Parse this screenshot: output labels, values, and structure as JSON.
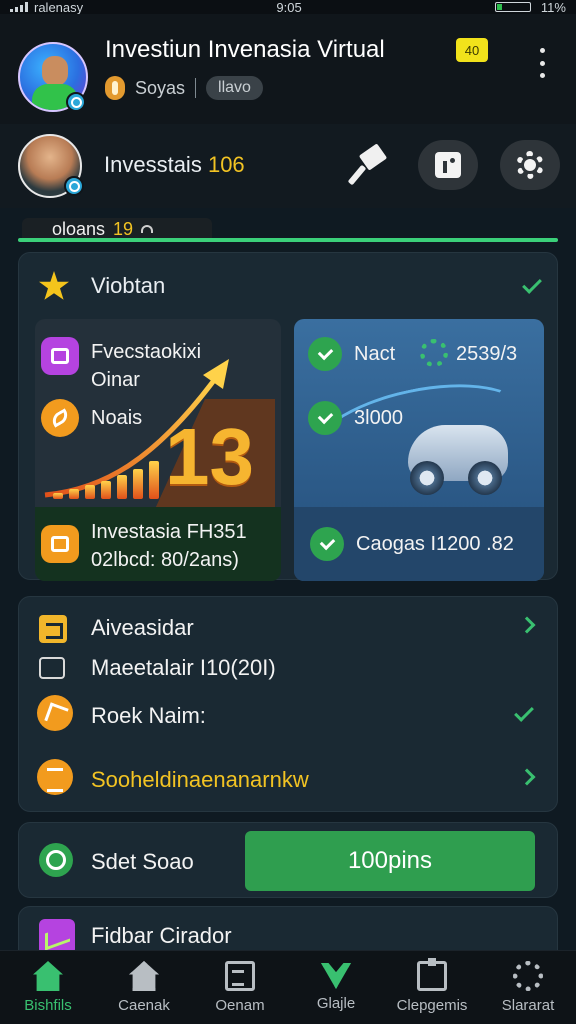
{
  "status_bar": {
    "carrier": "ralenasy",
    "time": "9:05",
    "battery": "11%",
    "battery_level": 0.11
  },
  "header": {
    "title": "Investiun Invenasia Virtual",
    "level": "40",
    "subtitle": "Soyas",
    "tag": "llavo"
  },
  "profile": {
    "name": "Invesstais",
    "score": "106"
  },
  "ticker": {
    "label": "oloans",
    "value": "19"
  },
  "overview_card": {
    "title": "Viobtan",
    "left_panel": {
      "item1": "Fvecstaokixi",
      "item1_sub": "Oinar",
      "item2": "Noais",
      "big_number": "13",
      "footer_line1": "Investasia FH351",
      "footer_line2": "02lbcd: 80/2ans)"
    },
    "right_panel": {
      "item1": "Nact",
      "item1_value": "2539/3",
      "item2": "3l000",
      "footer": "Caogas I1200 .82"
    }
  },
  "list_card": {
    "rows": [
      {
        "label": "Aiveasidar"
      },
      {
        "label": "Maeetalair I10(20I)"
      },
      {
        "label": "Roek Naim:"
      },
      {
        "label": "Sooheldinaenanarnkw"
      }
    ]
  },
  "action_card": {
    "label": "Sdet Soao",
    "button": "100pins"
  },
  "partial_card": {
    "label": "Fidbar Cirador"
  },
  "bottom_nav": [
    {
      "label": "Bishfils",
      "icon": "home-icon",
      "active": true
    },
    {
      "label": "Caenak",
      "icon": "house-icon",
      "active": false
    },
    {
      "label": "Oenam",
      "icon": "document-icon",
      "active": false
    },
    {
      "label": "Glajle",
      "icon": "heart-icon",
      "active": false
    },
    {
      "label": "Clepgemis",
      "icon": "clipboard-icon",
      "active": false
    },
    {
      "label": "Slararat",
      "icon": "settings-icon",
      "active": false
    }
  ],
  "colors": {
    "accent": "#39c070",
    "highlight": "#f2c323",
    "background": "#0f1a22"
  }
}
